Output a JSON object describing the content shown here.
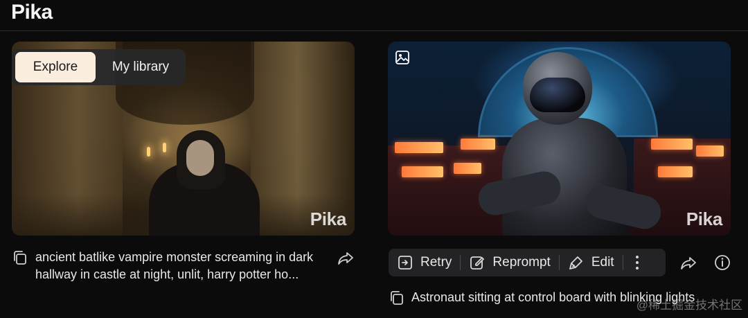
{
  "app": {
    "title": "Pika"
  },
  "tabs": [
    {
      "label": "Explore",
      "active": true
    },
    {
      "label": "My library",
      "active": false
    }
  ],
  "cards": [
    {
      "watermark": "Pika",
      "prompt": "ancient batlike vampire monster screaming in dark hallway in castle at night, unlit, harry potter ho..."
    },
    {
      "watermark": "Pika",
      "prompt": "Astronaut sitting at control board with blinking lights",
      "actions": {
        "retry": "Retry",
        "reprompt": "Reprompt",
        "edit": "Edit"
      }
    }
  ],
  "footer_watermark": "@稀土掘金技术社区",
  "colors": {
    "background": "#0b0b0c",
    "active_tab": "#fbeede",
    "action_bar": "#232325"
  }
}
